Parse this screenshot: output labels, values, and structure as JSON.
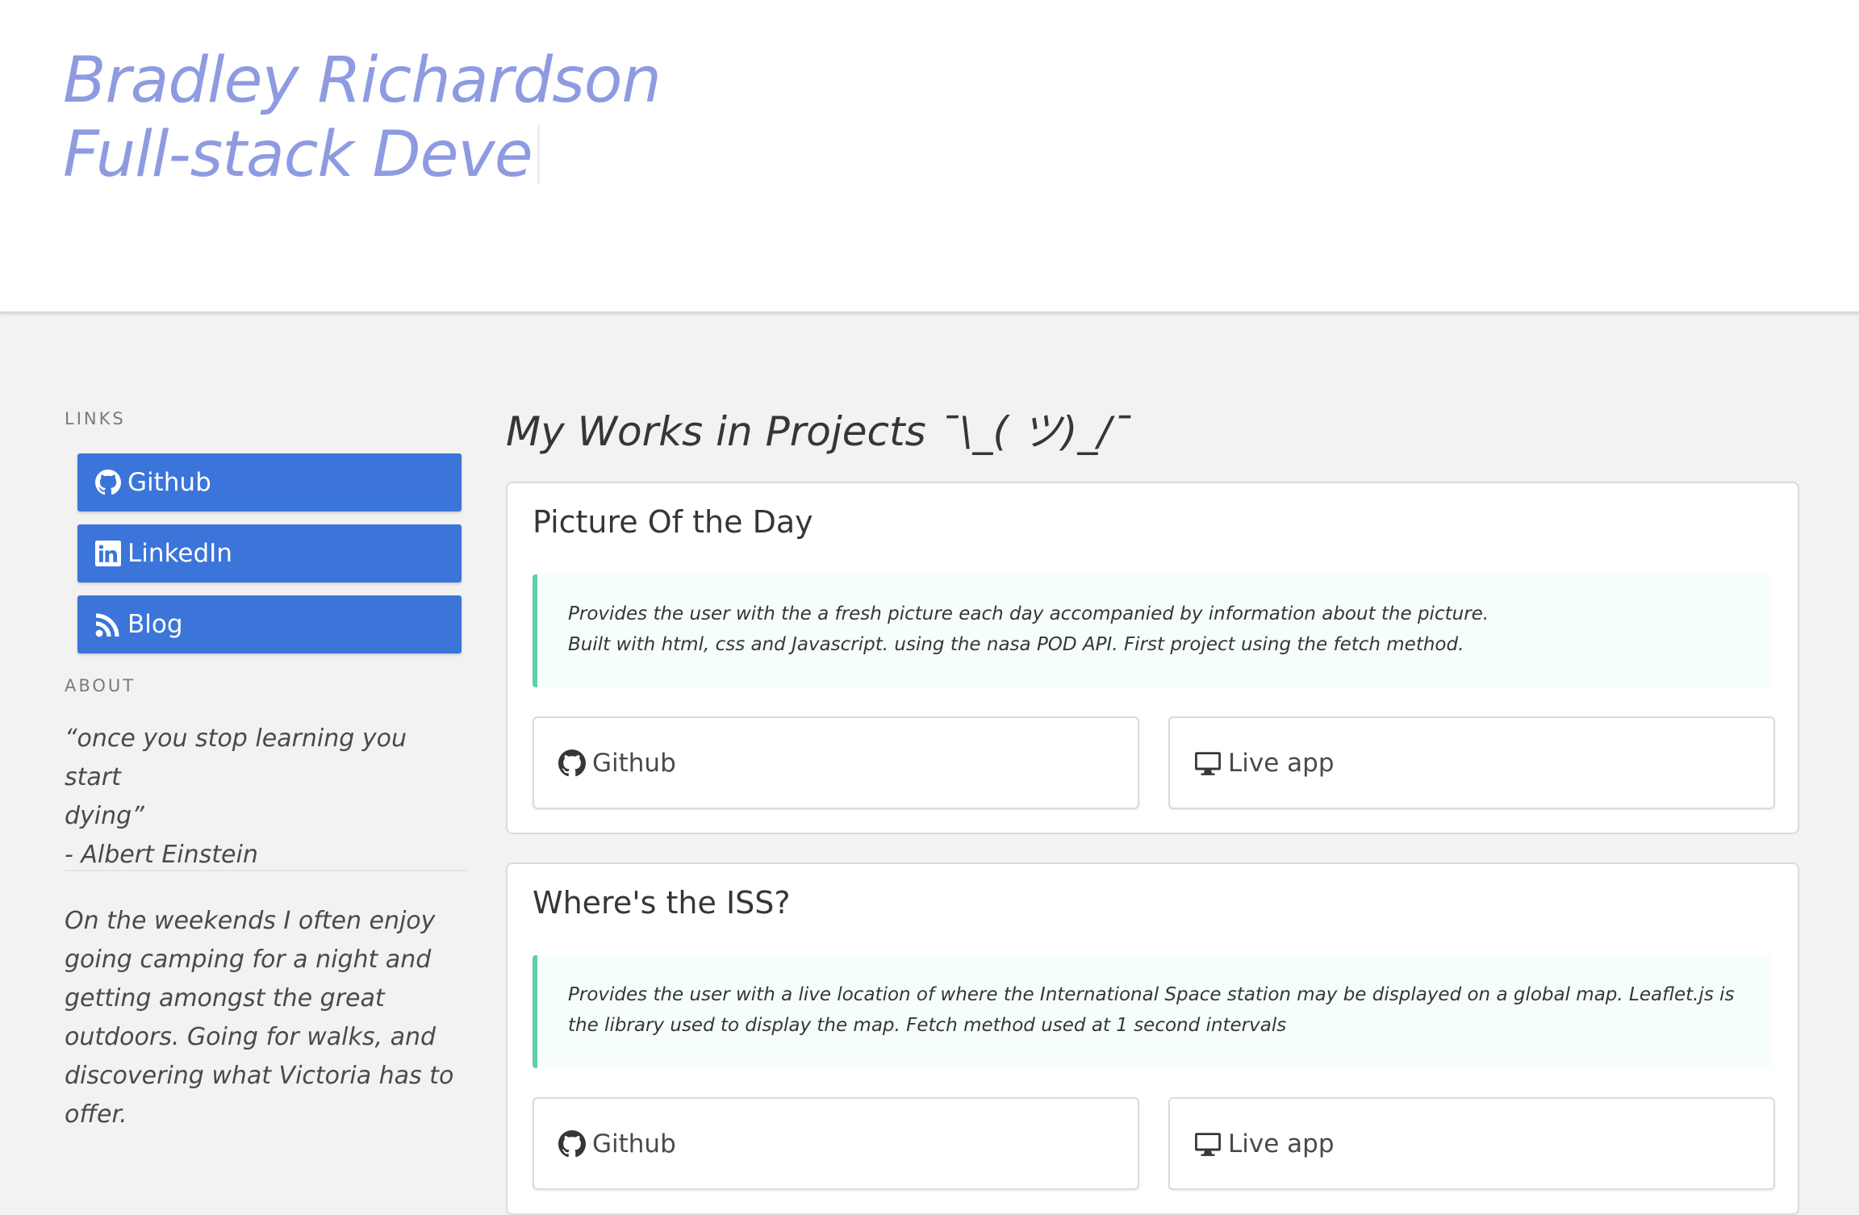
{
  "hero": {
    "name": "Bradley Richardson",
    "role_typed": "Full-stack Deve"
  },
  "sidebar": {
    "links_label": "LINKS",
    "links": [
      {
        "label": "Github",
        "icon": "github-icon"
      },
      {
        "label": "LinkedIn",
        "icon": "linkedin-icon"
      },
      {
        "label": "Blog",
        "icon": "rss-icon"
      }
    ],
    "about_label": "ABOUT",
    "quote_line1": "“once you stop learning you start",
    "quote_line2": "dying”",
    "quote_author": "- Albert Einstein",
    "about_lines": [
      "On the weekends I often enjoy",
      "going camping for a night and",
      "getting amongst the great",
      "outdoors. Going for walks, and",
      "discovering what Victoria has to",
      "offer."
    ]
  },
  "main": {
    "title": "My Works in Projects ¯\\_( ツ)_/¯",
    "projects": [
      {
        "title": "Picture Of the Day",
        "description_lines": [
          "Provides the user with the a fresh picture each day accompanied by information about the picture.",
          "Built with html, css and Javascript. using the nasa POD API. First project using the fetch method."
        ],
        "github_label": "Github",
        "live_label": "Live app"
      },
      {
        "title": "Where's the ISS?",
        "description_lines": [
          "Provides the user with a live location of where the International Space station may be displayed on a global map. Leaflet.js is",
          "the library used to display the map. Fetch method used at 1 second intervals"
        ],
        "github_label": "Github",
        "live_label": "Live app"
      }
    ]
  },
  "colors": {
    "hero_text": "#8e9be0",
    "link_button": "#3b75d9",
    "notice_border": "#5ecfa6",
    "notice_bg": "#f5fefb",
    "page_bg": "#f2f2f2"
  }
}
